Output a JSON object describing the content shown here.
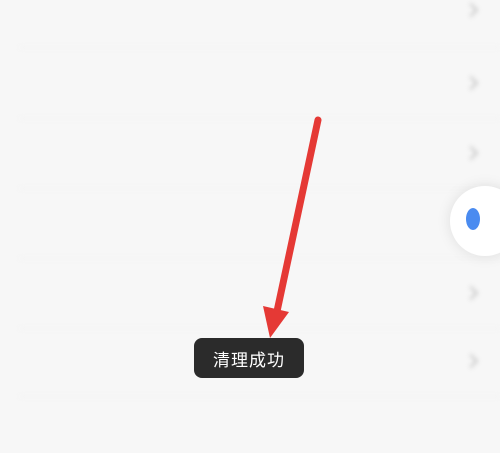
{
  "settings": {
    "rows": [
      {
        "label": "",
        "value": ""
      },
      {
        "label": "",
        "value": ""
      },
      {
        "label": "",
        "value": ""
      },
      {
        "label": "",
        "value": ""
      },
      {
        "label": "",
        "value": ""
      },
      {
        "label": "",
        "value": ""
      },
      {
        "label": "",
        "value": ""
      }
    ]
  },
  "toast": {
    "message": "清理成功"
  },
  "annotation": {
    "arrow_color": "#e53935"
  },
  "colors": {
    "background": "#f7f7f7",
    "toast_bg": "#2b2b2b",
    "accent": "#4a8bf0"
  }
}
